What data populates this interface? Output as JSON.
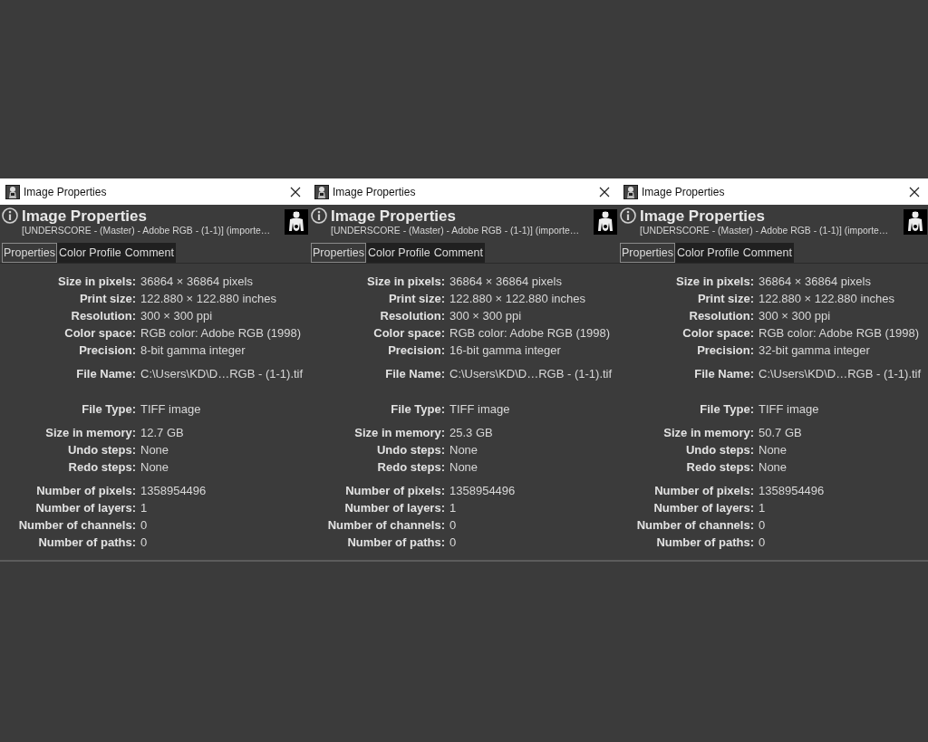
{
  "panels": [
    {
      "window_title": "Image Properties",
      "header": {
        "title": "Image Properties",
        "subtitle": "[UNDERSCORE - (Master) - Adobe RGB - (1-1)] (importe…"
      },
      "tabs": [
        {
          "label": "Properties",
          "selected": true
        },
        {
          "label": "Color Profile",
          "selected": false
        },
        {
          "label": "Comment",
          "selected": false
        }
      ],
      "sections": [
        [
          {
            "label": "Size in pixels:",
            "value": "36864 × 36864 pixels"
          },
          {
            "label": "Print size:",
            "value": "122.880 × 122.880 inches"
          },
          {
            "label": "Resolution:",
            "value": "300 × 300 ppi"
          },
          {
            "label": "Color space:",
            "value": "RGB color: Adobe RGB (1998)"
          },
          {
            "label": "Precision:",
            "value": "8-bit gamma integer"
          }
        ],
        [
          {
            "label": "File Name:",
            "value": "C:\\Users\\KD\\D…RGB - (1-1).tif"
          }
        ],
        [
          {
            "label": "File Type:",
            "value": "TIFF image"
          }
        ],
        [
          {
            "label": "Size in memory:",
            "value": "12.7 GB"
          },
          {
            "label": "Undo steps:",
            "value": "None"
          },
          {
            "label": "Redo steps:",
            "value": "None"
          }
        ],
        [
          {
            "label": "Number of pixels:",
            "value": "1358954496"
          },
          {
            "label": "Number of layers:",
            "value": "1"
          },
          {
            "label": "Number of channels:",
            "value": "0"
          },
          {
            "label": "Number of paths:",
            "value": "0"
          }
        ]
      ]
    },
    {
      "window_title": "Image Properties",
      "header": {
        "title": "Image Properties",
        "subtitle": "[UNDERSCORE - (Master) - Adobe RGB - (1-1)] (importe…"
      },
      "tabs": [
        {
          "label": "Properties",
          "selected": true
        },
        {
          "label": "Color Profile",
          "selected": false
        },
        {
          "label": "Comment",
          "selected": false
        }
      ],
      "sections": [
        [
          {
            "label": "Size in pixels:",
            "value": "36864 × 36864 pixels"
          },
          {
            "label": "Print size:",
            "value": "122.880 × 122.880 inches"
          },
          {
            "label": "Resolution:",
            "value": "300 × 300 ppi"
          },
          {
            "label": "Color space:",
            "value": "RGB color: Adobe RGB (1998)"
          },
          {
            "label": "Precision:",
            "value": "16-bit gamma integer"
          }
        ],
        [
          {
            "label": "File Name:",
            "value": "C:\\Users\\KD\\D…RGB - (1-1).tif"
          }
        ],
        [
          {
            "label": "File Type:",
            "value": "TIFF image"
          }
        ],
        [
          {
            "label": "Size in memory:",
            "value": "25.3 GB"
          },
          {
            "label": "Undo steps:",
            "value": "None"
          },
          {
            "label": "Redo steps:",
            "value": "None"
          }
        ],
        [
          {
            "label": "Number of pixels:",
            "value": "1358954496"
          },
          {
            "label": "Number of layers:",
            "value": "1"
          },
          {
            "label": "Number of channels:",
            "value": "0"
          },
          {
            "label": "Number of paths:",
            "value": "0"
          }
        ]
      ]
    },
    {
      "window_title": "Image Properties",
      "header": {
        "title": "Image Properties",
        "subtitle": "[UNDERSCORE - (Master) - Adobe RGB - (1-1)] (importe…"
      },
      "tabs": [
        {
          "label": "Properties",
          "selected": true
        },
        {
          "label": "Color Profile",
          "selected": false
        },
        {
          "label": "Comment",
          "selected": false
        }
      ],
      "sections": [
        [
          {
            "label": "Size in pixels:",
            "value": "36864 × 36864 pixels"
          },
          {
            "label": "Print size:",
            "value": "122.880 × 122.880 inches"
          },
          {
            "label": "Resolution:",
            "value": "300 × 300 ppi"
          },
          {
            "label": "Color space:",
            "value": "RGB color: Adobe RGB (1998)"
          },
          {
            "label": "Precision:",
            "value": "32-bit gamma integer"
          }
        ],
        [
          {
            "label": "File Name:",
            "value": "C:\\Users\\KD\\D…RGB - (1-1).tif"
          }
        ],
        [
          {
            "label": "File Type:",
            "value": "TIFF image"
          }
        ],
        [
          {
            "label": "Size in memory:",
            "value": "50.7 GB"
          },
          {
            "label": "Undo steps:",
            "value": "None"
          },
          {
            "label": "Redo steps:",
            "value": "None"
          }
        ],
        [
          {
            "label": "Number of pixels:",
            "value": "1358954496"
          },
          {
            "label": "Number of layers:",
            "value": "1"
          },
          {
            "label": "Number of channels:",
            "value": "0"
          },
          {
            "label": "Number of paths:",
            "value": "0"
          }
        ]
      ]
    }
  ]
}
